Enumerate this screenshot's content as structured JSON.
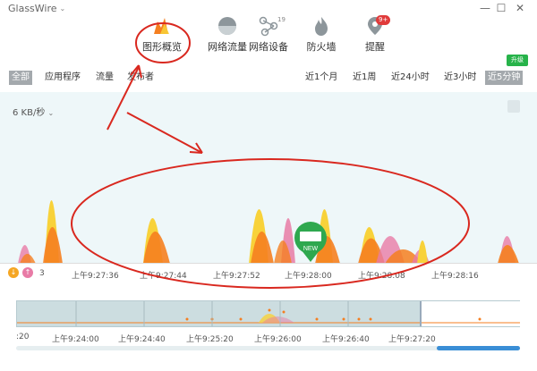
{
  "app": {
    "name": "GlassWire"
  },
  "nav": {
    "items": [
      {
        "label": "图形概览"
      },
      {
        "label": "网络流量"
      },
      {
        "label": "网络设备",
        "badge": "19"
      },
      {
        "label": "防火墙"
      },
      {
        "label": "提醒",
        "badge": "9+"
      }
    ],
    "upgrade": "升级"
  },
  "filters": {
    "left": [
      "全部",
      "应用程序",
      "流量",
      "发布者"
    ],
    "ranges": [
      "近1个月",
      "近1周",
      "近24小时",
      "近3小时",
      "近5分钟"
    ]
  },
  "graph": {
    "unit": "6 KB/秒",
    "new_badge": "NEW",
    "time_labels": [
      "上午9:27:36",
      "上午9:27:44",
      "上午9:27:52",
      "上午9:28:00",
      "上午9:28:08",
      "上午9:28:16"
    ],
    "left_count": "3"
  },
  "overview": {
    "time_labels": [
      ":20",
      "上午9:24:00",
      "上午9:24:40",
      "上午9:25:20",
      "上午9:26:00",
      "上午9:26:40",
      "上午9:27:20"
    ]
  },
  "colors": {
    "accent": "#f5a623",
    "peak_orange": "#f57f20",
    "peak_yellow": "#f8d23a",
    "peak_pink": "#e87ba6",
    "annotation": "#d9281f"
  }
}
